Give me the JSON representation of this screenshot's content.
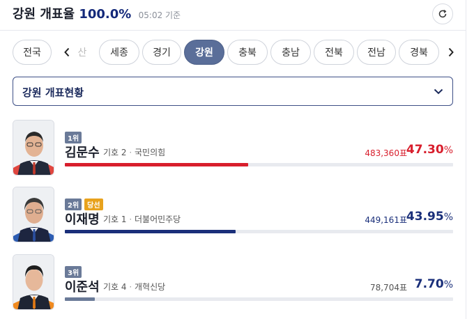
{
  "header": {
    "region": "강원 개표율",
    "rate": "100.0%",
    "time": "05:02 기준",
    "refresh_icon": "refresh-icon"
  },
  "tabs": [
    {
      "label": "전국",
      "active": false
    },
    {
      "label": "산",
      "active": false
    },
    {
      "label": "세종",
      "active": false
    },
    {
      "label": "경기",
      "active": false
    },
    {
      "label": "강원",
      "active": true
    },
    {
      "label": "충북",
      "active": false
    },
    {
      "label": "충남",
      "active": false
    },
    {
      "label": "전북",
      "active": false
    },
    {
      "label": "전남",
      "active": false
    },
    {
      "label": "경북",
      "active": false
    }
  ],
  "dropdown": {
    "label": "강원 개표현황"
  },
  "candidates": [
    {
      "rank": "1위",
      "winner": "",
      "name": "김문수",
      "number": "기호 2",
      "party": "국민의힘",
      "votes": "483,360표",
      "percent": "47.30",
      "share": 0.473,
      "color": "#d81e2c"
    },
    {
      "rank": "2위",
      "winner": "당선",
      "name": "이재명",
      "number": "기호 1",
      "party": "더불어민주당",
      "votes": "449,161표",
      "percent": "43.95",
      "share": 0.4395,
      "color": "#1a2f7a"
    },
    {
      "rank": "3위",
      "winner": "",
      "name": "이준석",
      "number": "기호 4",
      "party": "개혁신당",
      "votes": "78,704표",
      "percent": "7.70",
      "share": 0.077,
      "color": "#6a7a98"
    }
  ],
  "percent_unit": "%",
  "colors": {
    "accent": "#14297a",
    "active_tab": "#5a6e99",
    "winner_badge": "#e8a21d"
  }
}
